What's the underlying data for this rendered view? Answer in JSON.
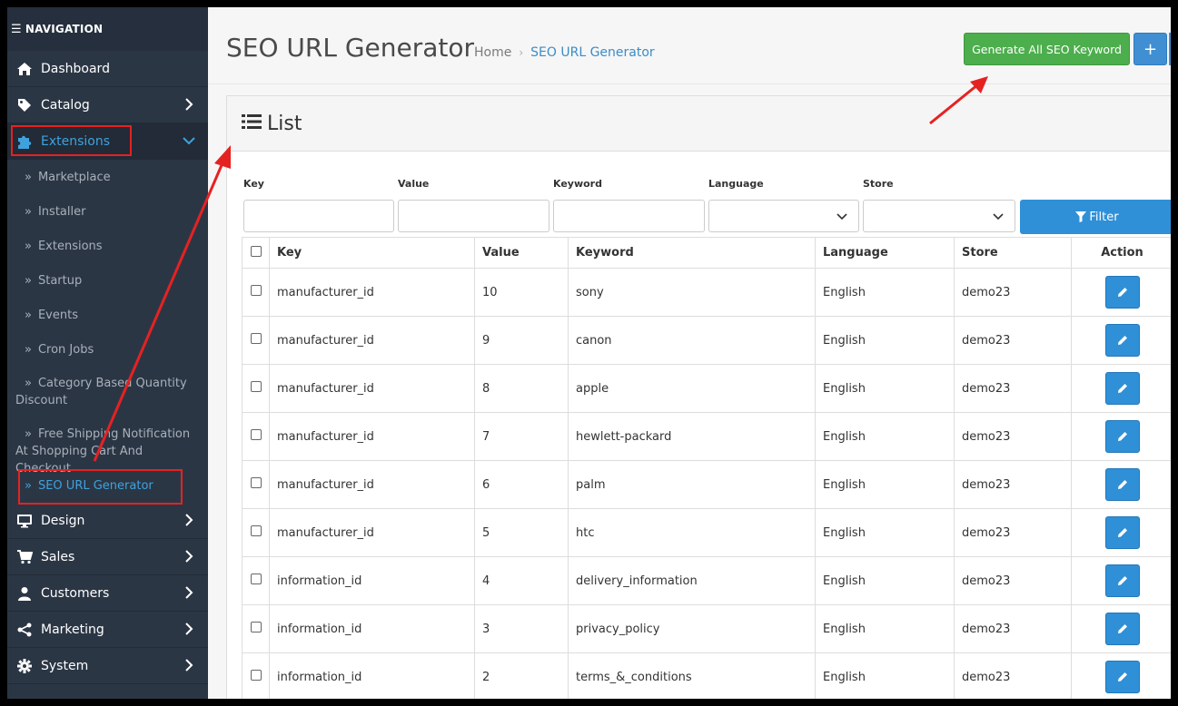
{
  "sidebar": {
    "header": "NAVIGATION",
    "items_top": [
      {
        "label": "Dashboard",
        "icon": "home-icon"
      },
      {
        "label": "Catalog",
        "icon": "tag-icon"
      },
      {
        "label": "Extensions",
        "icon": "puzzle-icon"
      }
    ],
    "subitems": [
      {
        "label": "Marketplace"
      },
      {
        "label": "Installer"
      },
      {
        "label": "Extensions"
      },
      {
        "label": "Startup"
      },
      {
        "label": "Events"
      },
      {
        "label": "Cron Jobs"
      },
      {
        "label": "Category Based Quantity Discount"
      },
      {
        "label": "Free Shipping Notification At Shopping Cart And Checkout"
      },
      {
        "label": "SEO URL Generator"
      }
    ],
    "items_bottom": [
      {
        "label": "Design",
        "icon": "desktop-icon"
      },
      {
        "label": "Sales",
        "icon": "cart-icon"
      },
      {
        "label": "Customers",
        "icon": "user-icon"
      },
      {
        "label": "Marketing",
        "icon": "share-icon"
      },
      {
        "label": "System",
        "icon": "gear-icon"
      }
    ]
  },
  "header": {
    "title": "SEO URL Generator",
    "breadcrumb": [
      "Home",
      "SEO URL Generator"
    ],
    "generate_label": "Generate All SEO Keyword",
    "add_label": "+"
  },
  "panel": {
    "title": "List",
    "filter": {
      "labels": [
        "Key",
        "Value",
        "Keyword",
        "Language",
        "Store"
      ],
      "button": "Filter"
    },
    "columns": [
      "Key",
      "Value",
      "Keyword",
      "Language",
      "Store",
      "Action"
    ],
    "rows": [
      [
        "manufacturer_id",
        "10",
        "sony",
        "English",
        "demo23"
      ],
      [
        "manufacturer_id",
        "9",
        "canon",
        "English",
        "demo23"
      ],
      [
        "manufacturer_id",
        "8",
        "apple",
        "English",
        "demo23"
      ],
      [
        "manufacturer_id",
        "7",
        "hewlett-packard",
        "English",
        "demo23"
      ],
      [
        "manufacturer_id",
        "6",
        "palm",
        "English",
        "demo23"
      ],
      [
        "manufacturer_id",
        "5",
        "htc",
        "English",
        "demo23"
      ],
      [
        "information_id",
        "4",
        "delivery_information",
        "English",
        "demo23"
      ],
      [
        "information_id",
        "3",
        "privacy_policy",
        "English",
        "demo23"
      ],
      [
        "information_id",
        "2",
        "terms_&_conditions",
        "English",
        "demo23"
      ]
    ]
  },
  "colors": {
    "sidebar_bg": "#2b3645",
    "accent": "#3fa2dd",
    "green_button": "#4cae4c",
    "blue_button": "#2f90d8",
    "annotation_red": "#e52222"
  }
}
